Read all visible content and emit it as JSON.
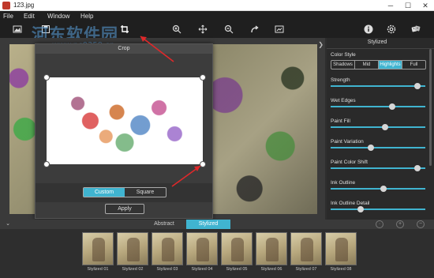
{
  "window": {
    "title": "123.jpg",
    "minimize": "─",
    "maximize": "☐",
    "close": "✕"
  },
  "menu": [
    "File",
    "Edit",
    "Window",
    "Help"
  ],
  "watermark": {
    "main": "河东软件园",
    "url": "www.pc0359.cn"
  },
  "toolbar": {
    "icons": [
      "image-open-icon",
      "save-icon",
      "crop-icon",
      "zoom-in-icon",
      "move-icon",
      "zoom-out-icon",
      "redo-icon",
      "fit-screen-icon",
      "info-icon",
      "settings-icon",
      "dice-icon"
    ]
  },
  "crop_dialog": {
    "title": "Crop",
    "options": [
      "Custom",
      "Square"
    ],
    "selected": "Custom",
    "apply": "Apply"
  },
  "panel": {
    "title": "Stylized",
    "color_style_label": "Color Style",
    "color_styles": [
      "Shadows",
      "Mid",
      "Highlights",
      "Full"
    ],
    "selected_style": "Highlights",
    "sliders": [
      {
        "label": "Strength",
        "value": 0.95
      },
      {
        "label": "Wet Edges",
        "value": 0.66
      },
      {
        "label": "Paint Fill",
        "value": 0.58
      },
      {
        "label": "Paint Variation",
        "value": 0.42
      },
      {
        "label": "Paint Color Shift",
        "value": 0.95
      },
      {
        "label": "Ink Outline",
        "value": 0.56
      },
      {
        "label": "Ink Outline Detail",
        "value": 0.3
      }
    ]
  },
  "tabs": {
    "collapse": "⌄",
    "items": [
      "Abstract",
      "Stylized"
    ],
    "selected": "Stylized"
  },
  "presets": [
    "Stylized 01",
    "Stylized 02",
    "Stylized 03",
    "Stylized 04",
    "Stylized 05",
    "Stylized 06",
    "Stylized 07",
    "Stylized 08"
  ],
  "accent_color": "#40b4d0"
}
